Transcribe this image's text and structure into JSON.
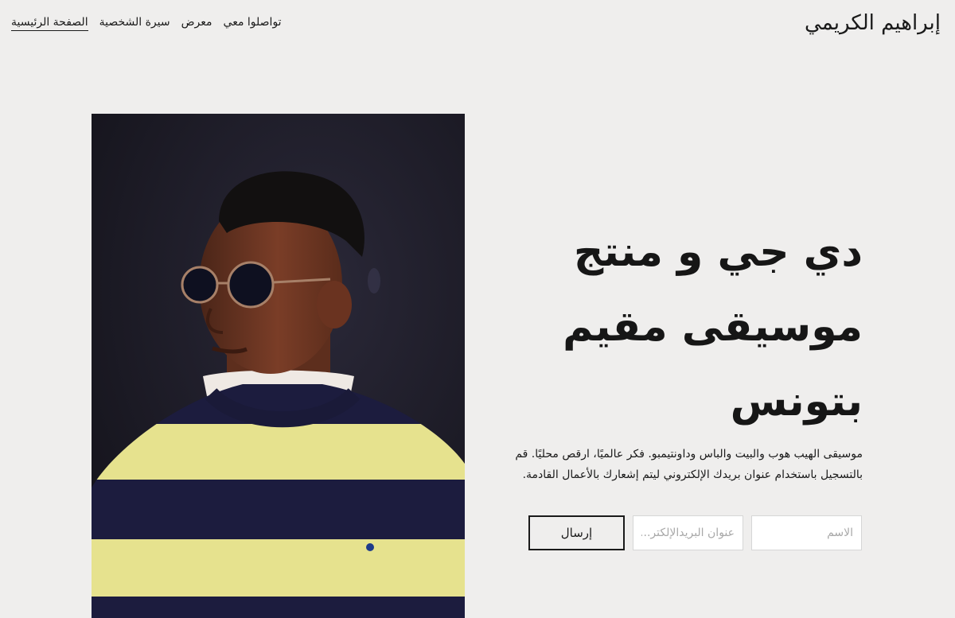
{
  "site": {
    "title": "إبراهيم الكريمي"
  },
  "nav": {
    "items": [
      {
        "label": "الصفحة الرئيسية",
        "active": true
      },
      {
        "label": "سيرة الشخصية"
      },
      {
        "label": "معرض"
      },
      {
        "label": "تواصلوا معي"
      }
    ]
  },
  "hero": {
    "headline_lines": [
      "دي جي و منتج",
      "موسيقى مقيم",
      "بتونس"
    ],
    "description_lines": [
      "موسيقى الهيب هوب والبيت والباس وداونتيمبو. فكر عالميًا، ارقص محليًا. قم",
      "بالتسجيل باستخدام عنوان بريدك الإلكتروني ليتم إشعارك بالأعمال القادمة."
    ]
  },
  "form": {
    "name_placeholder": "الاسم",
    "email_placeholder": "عنوان البريدالإلكتر...",
    "submit_label": "إرسال"
  },
  "colors": {
    "background": "#efeeed",
    "text": "#1a1a1a",
    "photo_backdrop": "#1c1a25",
    "sweater_yellow": "#e6e28e",
    "sweater_navy": "#1c1c3e"
  }
}
